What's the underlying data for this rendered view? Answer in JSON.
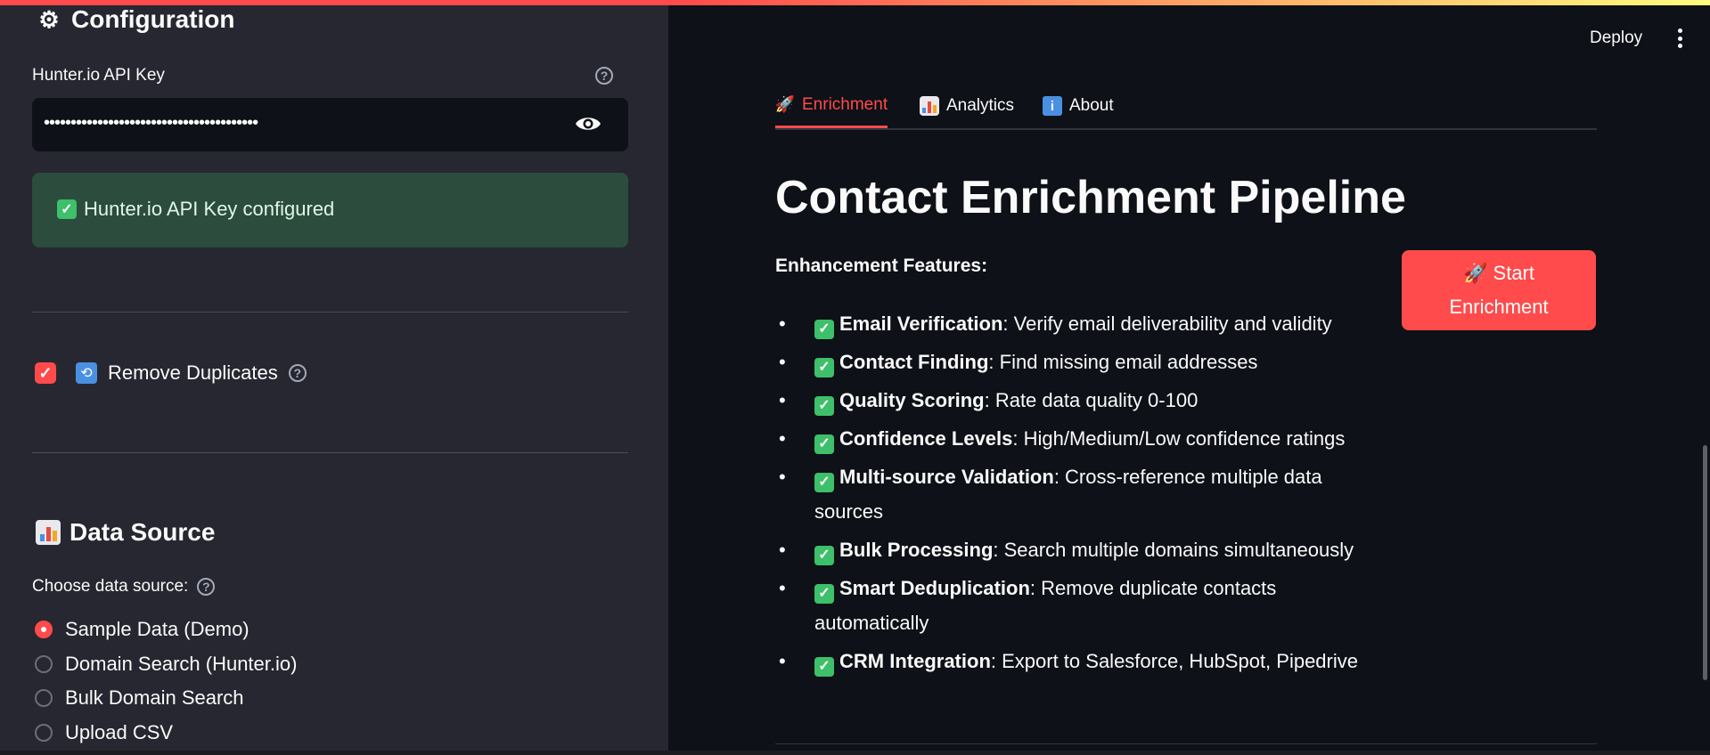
{
  "colors": {
    "primary": "#ff4b4b",
    "sidebar_bg": "#262730",
    "main_bg": "#0e1117",
    "success_bg": "#2c4c3d",
    "check_green": "#3ebf6a"
  },
  "sidebar": {
    "config_title": "Configuration",
    "config_icon": "gear-icon",
    "api_key_label": "Hunter.io API Key",
    "api_key_value": "••••••••••••••••••••••••••••••••••••••••",
    "api_key_visibility_icon": "eye-icon",
    "api_status": "Hunter.io API Key configured",
    "remove_duplicates": {
      "label": "Remove Duplicates",
      "checked": true
    },
    "data_source_title": "Data Source",
    "data_source_icon": "bar-chart-icon",
    "choose_label": "Choose data source:",
    "options": [
      {
        "label": "Sample Data (Demo)",
        "selected": true
      },
      {
        "label": "Domain Search (Hunter.io)",
        "selected": false
      },
      {
        "label": "Bulk Domain Search",
        "selected": false
      },
      {
        "label": "Upload CSV",
        "selected": false
      }
    ]
  },
  "header": {
    "deploy_label": "Deploy",
    "menu_icon": "vertical-dots-icon"
  },
  "tabs": [
    {
      "label": "Enrichment",
      "icon": "rocket-icon",
      "active": true
    },
    {
      "label": "Analytics",
      "icon": "bar-chart-icon",
      "active": false
    },
    {
      "label": "About",
      "icon": "info-icon",
      "active": false
    }
  ],
  "main": {
    "title": "Contact Enrichment Pipeline",
    "features_heading": "Enhancement Features:",
    "features": [
      {
        "name": "Email Verification",
        "desc": ": Verify email deliverability and validity"
      },
      {
        "name": "Contact Finding",
        "desc": ": Find missing email addresses"
      },
      {
        "name": "Quality Scoring",
        "desc": ": Rate data quality 0-100"
      },
      {
        "name": "Confidence Levels",
        "desc": ": High/Medium/Low confidence ratings"
      },
      {
        "name": "Multi-source Validation",
        "desc": ": Cross-reference multiple data sources"
      },
      {
        "name": "Bulk Processing",
        "desc": ": Search multiple domains simultaneously"
      },
      {
        "name": "Smart Deduplication",
        "desc": ": Remove duplicate contacts automatically"
      },
      {
        "name": "CRM Integration",
        "desc": ": Export to Salesforce, HubSpot, Pipedrive"
      }
    ],
    "start_button": {
      "icon": "rocket-icon",
      "label_line1": "Start",
      "label_line2": "Enrichment"
    }
  }
}
